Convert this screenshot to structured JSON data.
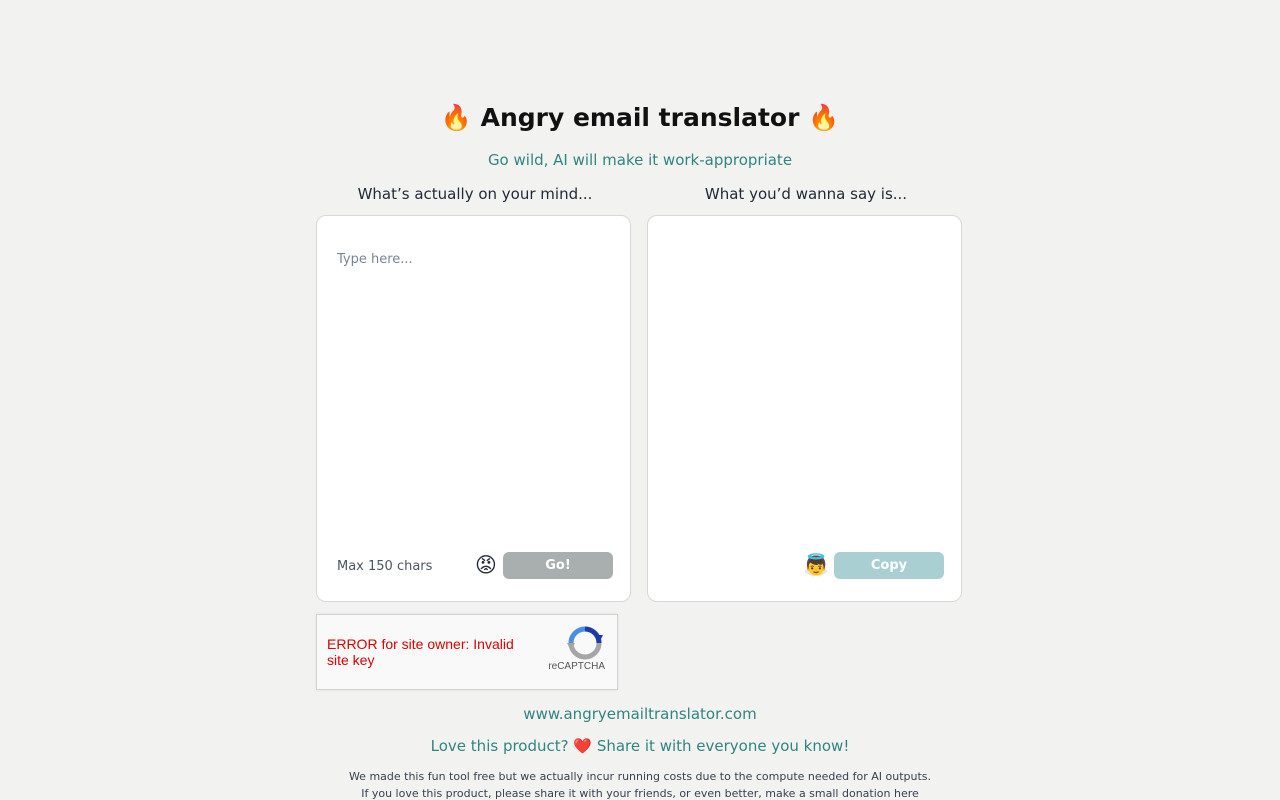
{
  "header": {
    "title_emoji_left": "🔥",
    "title": "Angry email translator",
    "title_emoji_right": "🔥",
    "subtitle": "Go wild, AI will make it work-appropriate"
  },
  "input_panel": {
    "label": "What’s actually on your mind...",
    "placeholder": "Type here...",
    "value": "",
    "max_chars_text": "Max 150 chars",
    "emoji": "😡",
    "go_button": "Go!"
  },
  "output_panel": {
    "label": "What you’d wanna say is...",
    "value": "",
    "emoji": "👼",
    "copy_button": "Copy"
  },
  "captcha": {
    "error": "ERROR for site owner: Invalid site key",
    "brand": "reCAPTCHA"
  },
  "footer": {
    "site_url": "www.angryemailtranslator.com",
    "share_before": "Love this product? ",
    "share_emoji": "❤️",
    "share_after": " Share it with everyone you know!",
    "note_line1": "We made this fun tool free but we actually incur running costs due to the compute needed for AI outputs.",
    "note_line2": "If you love this product, please share it with your friends, or even better, make a small donation here"
  },
  "colors": {
    "background": "#f2f2f1",
    "accent_teal": "#2f8582",
    "go_button": "#a9aeae",
    "copy_button": "#aacfd2",
    "captcha_error": "#e00000"
  }
}
